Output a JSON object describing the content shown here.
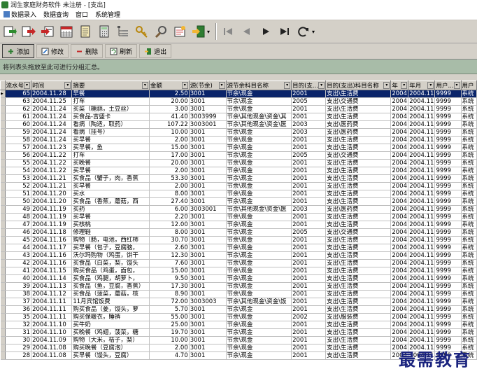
{
  "window": {
    "title": "润生家庭财务软件 未注册 - [支出]"
  },
  "menu": [
    "数据录入",
    "数据查询",
    "窗口",
    "系统管理"
  ],
  "toolbar_icons": [
    "entry-icon",
    "export-icon",
    "import-icon",
    "calendar-icon",
    "notes-icon",
    "calculator-icon",
    "tree-icon",
    "key-icon",
    "tools-icon",
    "report-icon",
    "exit-icon"
  ],
  "actions": {
    "add": "添加",
    "edit": "修改",
    "delete": "删除",
    "refresh": "刷新",
    "exit": "退出"
  },
  "groupbar": "将列表头拖放至此可进行分组汇总。",
  "columns": [
    "流水号",
    "时间",
    "摘要",
    "金额",
    "源(节余)",
    "源节余科目名称",
    "目的(支...",
    "目的(支出)科目名称",
    "年",
    "年月",
    "用户...",
    "用户"
  ],
  "rows": [
    [
      "65",
      "2004.11.28",
      "早餐",
      "2.50",
      "3001",
      "节余\\现金",
      "2001",
      "支出\\生活费",
      "2004",
      "2004.11",
      "9999",
      "系统"
    ],
    [
      "63",
      "2004.11.25",
      "打车",
      "20.00",
      "3001",
      "节余\\现金",
      "2005",
      "支出\\交通费",
      "2004",
      "2004.11",
      "9999",
      "系统"
    ],
    [
      "62",
      "2004.11.24",
      "买菜（糖蒜，土豆丝）",
      "3.00",
      "3001",
      "节余\\现金",
      "2001",
      "支出\\生活费",
      "2004",
      "2004.11",
      "9999",
      "系统"
    ],
    [
      "61",
      "2004.11.24",
      "买食品-吉盛卡",
      "41.40",
      "3003999",
      "节余\\其他现金\\资金\\其",
      "2001",
      "支出\\生活费",
      "2004",
      "2004.11",
      "9999",
      "系统"
    ],
    [
      "60",
      "2004.11.24",
      "看病（陶适，取药）",
      "107.22",
      "3003001",
      "节余\\其他现金\\资金\\医",
      "2003",
      "支出\\医药费",
      "2004",
      "2004.11",
      "9999",
      "系统"
    ],
    [
      "59",
      "2004.11.24",
      "看病（挂号）",
      "10.00",
      "3001",
      "节余\\现金",
      "2003",
      "支出\\医药费",
      "2004",
      "2004.11",
      "9999",
      "系统"
    ],
    [
      "58",
      "2004.11.24",
      "买早餐",
      "2.00",
      "3001",
      "节余\\现金",
      "2001",
      "支出\\生活费",
      "2004",
      "2004.11",
      "9999",
      "系统"
    ],
    [
      "57",
      "2004.11.23",
      "买早餐，鱼",
      "15.00",
      "3001",
      "节余\\现金",
      "2001",
      "支出\\生活费",
      "2004",
      "2004.11",
      "9999",
      "系统"
    ],
    [
      "56",
      "2004.11.22",
      "打车",
      "17.00",
      "3001",
      "节余\\现金",
      "2005",
      "支出\\交通费",
      "2004",
      "2004.11",
      "9999",
      "系统"
    ],
    [
      "55",
      "2004.11.22",
      "买晚餐",
      "20.00",
      "3001",
      "节余\\现金",
      "2001",
      "支出\\生活费",
      "2004",
      "2004.11",
      "9999",
      "系统"
    ],
    [
      "54",
      "2004.11.22",
      "买早餐",
      "2.00",
      "3001",
      "节余\\现金",
      "2001",
      "支出\\生活费",
      "2004",
      "2004.11",
      "9999",
      "系统"
    ],
    [
      "53",
      "2004.11.21",
      "买食品（蟹子，肉，香蕉",
      "53.30",
      "3001",
      "节余\\现金",
      "2001",
      "支出\\生活费",
      "2004",
      "2004.11",
      "9999",
      "系统"
    ],
    [
      "52",
      "2004.11.21",
      "买早餐",
      "2.00",
      "3001",
      "节余\\现金",
      "2001",
      "支出\\生活费",
      "2004",
      "2004.11",
      "9999",
      "系统"
    ],
    [
      "51",
      "2004.11.20",
      "买水",
      "8.00",
      "3001",
      "节余\\现金",
      "2001",
      "支出\\生活费",
      "2004",
      "2004.11",
      "9999",
      "系统"
    ],
    [
      "50",
      "2004.11.20",
      "买食品（香蕉，蘑菇，西",
      "27.40",
      "3001",
      "节余\\现金",
      "2001",
      "支出\\生活费",
      "2004",
      "2004.11",
      "9999",
      "系统"
    ],
    [
      "49",
      "2004.11.19",
      "买药",
      "6.00",
      "3003001",
      "节余\\其他现金\\资金\\医",
      "2003",
      "支出\\医药费",
      "2004",
      "2004.11",
      "9999",
      "系统"
    ],
    [
      "48",
      "2004.11.19",
      "买早餐",
      "2.20",
      "3001",
      "节余\\现金",
      "2001",
      "支出\\生活费",
      "2004",
      "2004.11",
      "9999",
      "系统"
    ],
    [
      "47",
      "2004.11.19",
      "买核桃",
      "12.00",
      "3001",
      "节余\\现金",
      "2001",
      "支出\\生活费",
      "2004",
      "2004.11",
      "9999",
      "系统"
    ],
    [
      "46",
      "2004.11.18",
      "修理鞋",
      "8.00",
      "3001",
      "节余\\现金",
      "2005",
      "支出\\交通费",
      "2004",
      "2004.11",
      "9999",
      "系统"
    ],
    [
      "45",
      "2004.11.16",
      "购物（肠，电池，西红柿",
      "30.70",
      "3001",
      "节余\\现金",
      "2001",
      "支出\\生活费",
      "2004",
      "2004.11",
      "9999",
      "系统"
    ],
    [
      "44",
      "2004.11.17",
      "买早餐（包子，豆腐脑，",
      "2.60",
      "3001",
      "节余\\现金",
      "2001",
      "支出\\生活费",
      "2004",
      "2004.11",
      "9999",
      "系统"
    ],
    [
      "43",
      "2004.11.16",
      "沃尔玛购物（鸡蛋，饼干",
      "12.30",
      "3001",
      "节余\\现金",
      "2001",
      "支出\\生活费",
      "2004",
      "2004.11",
      "9999",
      "系统"
    ],
    [
      "42",
      "2004.11.16",
      "买食品（白菜，梨，馒头",
      "7.60",
      "3001",
      "节余\\现金",
      "2001",
      "支出\\生活费",
      "2004",
      "2004.11",
      "9999",
      "系统"
    ],
    [
      "41",
      "2004.11.15",
      "购买食品（鸡蛋，面包，",
      "15.00",
      "3001",
      "节余\\现金",
      "2001",
      "支出\\生活费",
      "2004",
      "2004.11",
      "9999",
      "系统"
    ],
    [
      "40",
      "2004.11.14",
      "买食品（鸡腿，胡萝卜，",
      "9.50",
      "3001",
      "节余\\现金",
      "2001",
      "支出\\生活费",
      "2004",
      "2004.11",
      "9999",
      "系统"
    ],
    [
      "39",
      "2004.11.13",
      "买食品（鱼，豆腐，香蕉）",
      "17.30",
      "3001",
      "节余\\现金",
      "2001",
      "支出\\生活费",
      "2004",
      "2004.11",
      "9999",
      "系统"
    ],
    [
      "38",
      "2004.11.12",
      "买食品（菠菜，蘑菇，核",
      "8.90",
      "3001",
      "节余\\现金",
      "2001",
      "支出\\生活费",
      "2004",
      "2004.11",
      "9999",
      "系统"
    ],
    [
      "37",
      "2004.11.11",
      "11月宾馆饭费",
      "72.00",
      "3003003",
      "节余\\其他现金\\资金\\饭",
      "2001",
      "支出\\生活费",
      "2004",
      "2004.11",
      "9999",
      "系统"
    ],
    [
      "36",
      "2004.11.11",
      "购买食品（姜，馒头，萝",
      "5.70",
      "3001",
      "节余\\现金",
      "2001",
      "支出\\生活费",
      "2004",
      "2004.11",
      "9999",
      "系统"
    ],
    [
      "35",
      "2004.11.11",
      "购买保暖衣，睡裤",
      "55.00",
      "3001",
      "节余\\现金",
      "2002",
      "支出\\服装费",
      "2004",
      "2004.11",
      "9999",
      "系统"
    ],
    [
      "32",
      "2004.11.10",
      "买牛奶",
      "25.00",
      "3001",
      "节余\\现金",
      "2001",
      "支出\\生活费",
      "2004",
      "2004.11",
      "9999",
      "系统"
    ],
    [
      "31",
      "2004.11.10",
      "买晚餐（鸡翅，菠菜，糖",
      "19.70",
      "3001",
      "节余\\现金",
      "2001",
      "支出\\生活费",
      "2004",
      "2004.11",
      "9999",
      "系统"
    ],
    [
      "30",
      "2004.11.09",
      "购物（大米，桔子，梨）",
      "10.00",
      "3001",
      "节余\\现金",
      "2001",
      "支出\\生活费",
      "2004",
      "2004.11",
      "9999",
      "系统"
    ],
    [
      "29",
      "2004.11.08",
      "购买晚餐（豆腐泡）",
      "2.00",
      "3001",
      "节余\\现金",
      "2001",
      "支出\\生活费",
      "2004",
      "2004.11",
      "9999",
      "系统"
    ],
    [
      "28",
      "2004.11.08",
      "买早餐（馒头，豆腐）",
      "4.70",
      "3001",
      "节余\\现金",
      "2001",
      "支出\\生活费",
      "2004",
      "2004.11",
      "9999",
      "系统"
    ]
  ],
  "watermark": "最需教育"
}
